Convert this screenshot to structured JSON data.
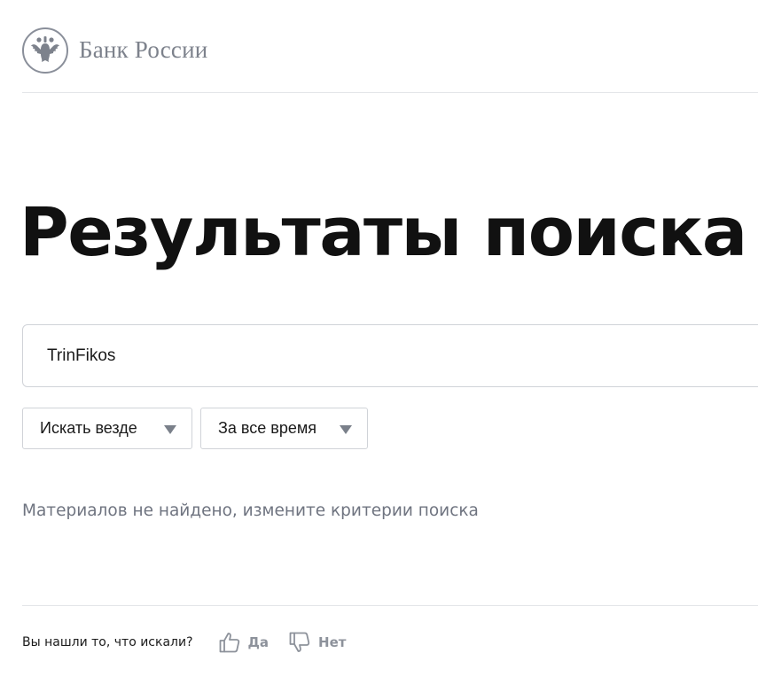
{
  "header": {
    "brand": "Банк России",
    "logo_icon": "double-headed-eagle-emblem"
  },
  "main": {
    "title": "Результаты поиска",
    "search": {
      "value": "TrinFikos",
      "placeholder": ""
    },
    "filters": {
      "scope": {
        "selected": "Искать везде",
        "icon": "triangle-down-icon"
      },
      "period": {
        "selected": "За все время",
        "icon": "triangle-down-icon"
      }
    },
    "empty_message": "Материалов не найдено, измените критерии поиска"
  },
  "feedback": {
    "question": "Вы нашли то, что искали?",
    "yes_label": "Да",
    "no_label": "Нет",
    "yes_icon": "thumbs-up-icon",
    "no_icon": "thumbs-down-icon"
  },
  "colors": {
    "text": "#1a1a1a",
    "muted": "#6f7480",
    "brand_gray": "#7d828c",
    "border": "#d0d3d8",
    "divider": "#e3e5e8"
  }
}
